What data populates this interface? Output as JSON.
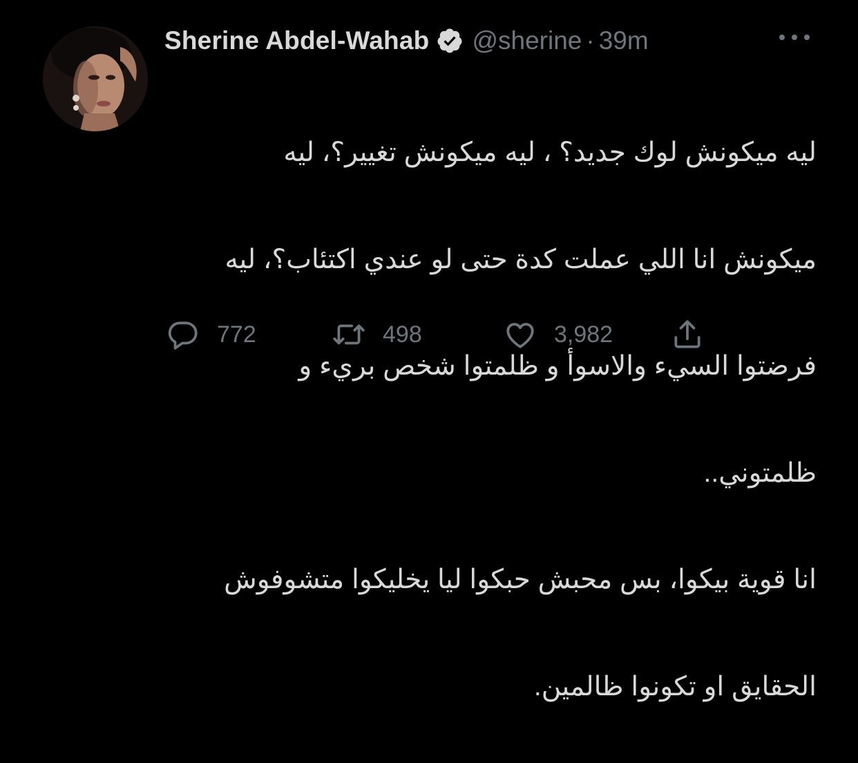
{
  "tweet": {
    "author_name": "Sherine Abdel-Wahab",
    "handle": "@sherine",
    "separator": "·",
    "time": "39m",
    "lines": [
      "ليه ميكونش لوك جديد؟ ، ليه ميكونش تغيير؟، ليه",
      "ميكونش انا اللي عملت كدة حتى لو عندي اكتئاب؟، ليه",
      "فرضتوا السيء والاسوأ و ظلمتوا شخص بريء و",
      "ظلمتوني..",
      "انا قوية بيكوا، بس محبش حبكوا ليا يخليكوا متشوفوش",
      "الحقايق او تكونوا ظالمين."
    ],
    "actions": {
      "replies": "772",
      "retweets": "498",
      "likes": "3,982"
    }
  },
  "icons": {
    "verified": "verified-badge-icon",
    "more": "more-horizontal-icon",
    "reply": "reply-icon",
    "retweet": "retweet-icon",
    "like": "like-icon",
    "share": "share-icon"
  },
  "colors": {
    "background": "#000000",
    "primary_text": "#d9d9d9",
    "secondary_text": "#6e767d"
  }
}
